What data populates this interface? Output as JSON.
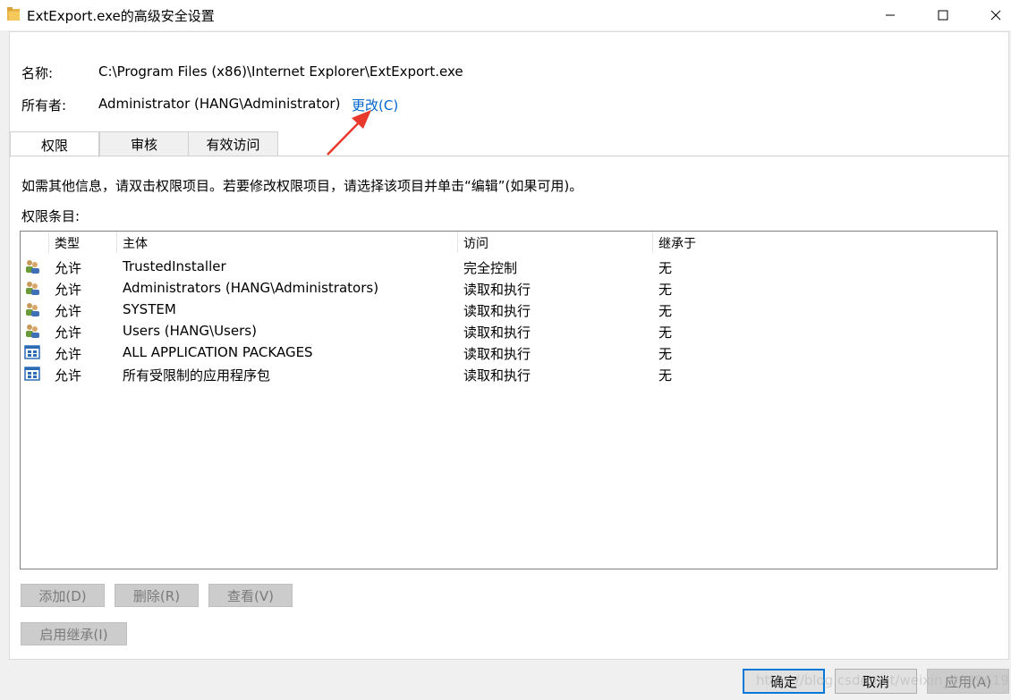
{
  "window": {
    "title": "ExtExport.exe的高级安全设置"
  },
  "info": {
    "name_label": "名称:",
    "name_value": "C:\\Program Files (x86)\\Internet Explorer\\ExtExport.exe",
    "owner_label": "所有者:",
    "owner_value": "Administrator (HANG\\Administrator)",
    "change_link": "更改(C)"
  },
  "tabs": [
    {
      "label": "权限",
      "active": true
    },
    {
      "label": "审核",
      "active": false
    },
    {
      "label": "有效访问",
      "active": false
    }
  ],
  "instructions": "如需其他信息，请双击权限项目。若要修改权限项目，请选择该项目并单击“编辑”(如果可用)。",
  "entries_label": "权限条目:",
  "table": {
    "columns": [
      "类型",
      "主体",
      "访问",
      "继承于"
    ],
    "rows": [
      {
        "icon": "users-icon",
        "type": "允许",
        "principal": "TrustedInstaller",
        "access": "完全控制",
        "inherited": "无"
      },
      {
        "icon": "users-icon",
        "type": "允许",
        "principal": "Administrators (HANG\\Administrators)",
        "access": "读取和执行",
        "inherited": "无"
      },
      {
        "icon": "users-icon",
        "type": "允许",
        "principal": "SYSTEM",
        "access": "读取和执行",
        "inherited": "无"
      },
      {
        "icon": "users-icon",
        "type": "允许",
        "principal": "Users (HANG\\Users)",
        "access": "读取和执行",
        "inherited": "无"
      },
      {
        "icon": "app-package-icon",
        "type": "允许",
        "principal": "ALL APPLICATION PACKAGES",
        "access": "读取和执行",
        "inherited": "无"
      },
      {
        "icon": "app-package-icon",
        "type": "允许",
        "principal": "所有受限制的应用程序包",
        "access": "读取和执行",
        "inherited": "无"
      }
    ]
  },
  "buttons": {
    "add": "添加(D)",
    "remove": "删除(R)",
    "view": "查看(V)",
    "enable_inheritance": "启用继承(I)"
  },
  "dialog_buttons": {
    "ok": "确定",
    "cancel": "取消",
    "apply": "应用(A)"
  },
  "watermark": "https://blog.csdn.net/weixin_40496191",
  "colors": {
    "link": "#0066cc",
    "accent": "#0078d7",
    "annotation_arrow": "#e8392c"
  }
}
